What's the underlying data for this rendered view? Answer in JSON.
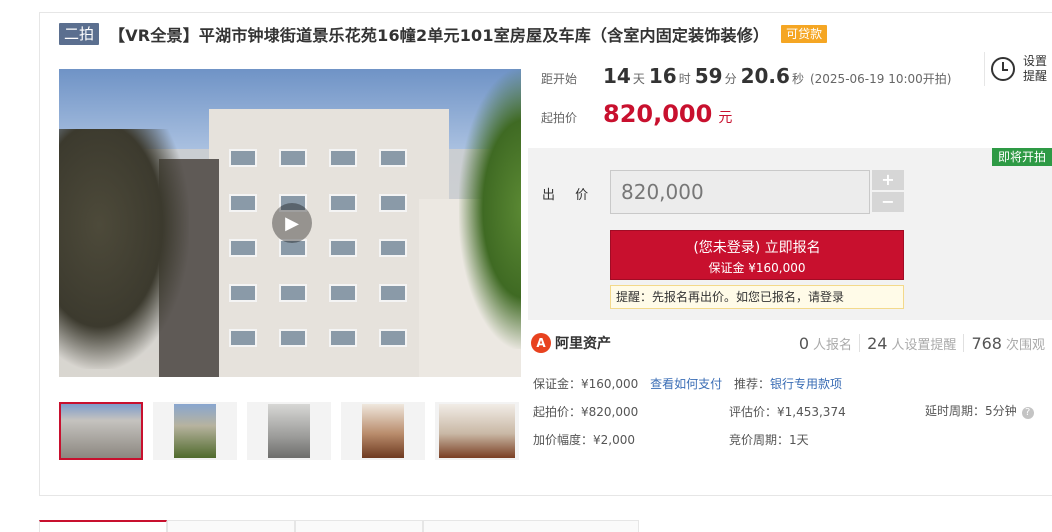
{
  "title": {
    "round_badge": "二拍",
    "text": "【VR全景】平湖市钟埭街道景乐花苑16幢2单元101室房屋及车库（含室内固定装饰装修）",
    "loan_badge": "可贷款"
  },
  "countdown": {
    "label": "距开始",
    "days": "14",
    "days_unit": "天",
    "hours": "16",
    "hours_unit": "时",
    "minutes": "59",
    "minutes_unit": "分",
    "seconds": "20.6",
    "seconds_unit": "秒",
    "start_time": "(2025-06-19 10:00开拍)"
  },
  "reminder": {
    "label": "设置提醒",
    "icon": "alarm-clock-icon"
  },
  "start_price": {
    "label": "起拍价",
    "value": "820,000",
    "unit": "元"
  },
  "bid": {
    "status_badge": "即将开拍",
    "label": "出 价",
    "input_value": "820,000",
    "plus": "+",
    "minus": "−",
    "signup_main": "(您未登录) 立即报名",
    "signup_sub": "保证金 ¥160,000",
    "tip_prefix": "提醒：先报名再出价。如您已报名，请",
    "tip_link": "登录"
  },
  "platform": {
    "logo_mark": "A",
    "name": "阿里资产"
  },
  "stats": [
    {
      "num": "0",
      "label": "人报名"
    },
    {
      "num": "24",
      "label": "人设置提醒"
    },
    {
      "num": "768",
      "label": "次围观"
    }
  ],
  "details": {
    "deposit": "保证金：¥160,000",
    "deposit_link": "查看如何支付",
    "recommend_label": "推荐：",
    "recommend_link": "银行专用款项",
    "start_price": "起拍价：¥820,000",
    "appraisal": "评估价：¥1,453,374",
    "delay": "延时周期：5分钟",
    "increment": "加价幅度：¥2,000",
    "cycle": "竞价周期：1天"
  },
  "colors": {
    "accent": "#c8102e",
    "badge": "#5b6f8f",
    "loan": "#f5a623",
    "coming": "#2e9a45",
    "link": "#3a6db5"
  }
}
